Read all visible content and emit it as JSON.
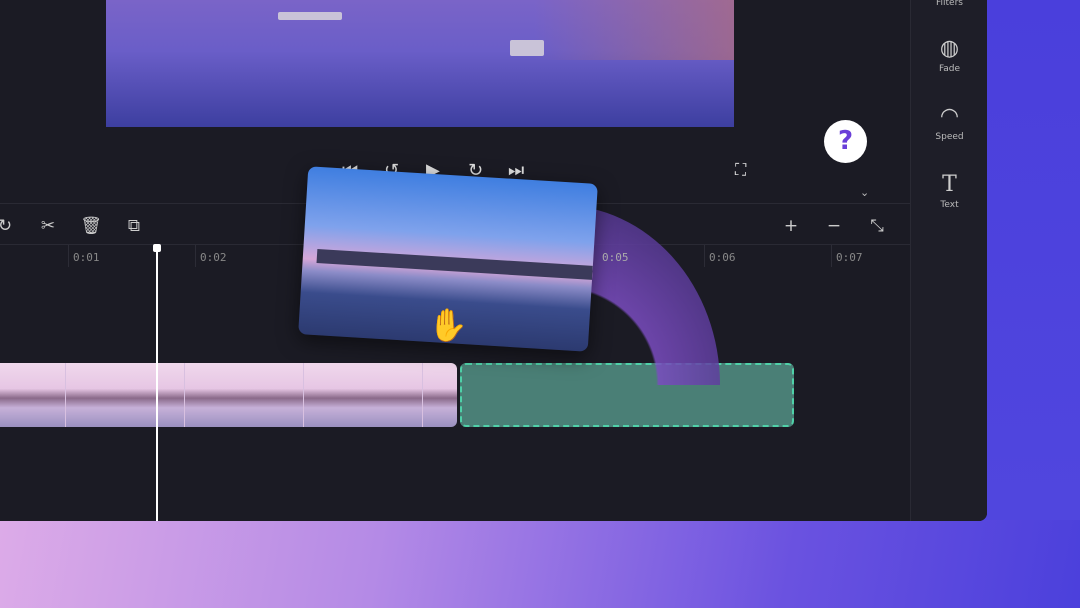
{
  "sidebar": {
    "items": [
      {
        "label": "Filters",
        "icon": "filters-icon"
      },
      {
        "label": "Fade",
        "icon": "fade-icon"
      },
      {
        "label": "Speed",
        "icon": "speed-icon"
      },
      {
        "label": "Text",
        "icon": "text-icon"
      }
    ]
  },
  "help": {
    "label": "?"
  },
  "ruler": {
    "ticks": [
      "0:01",
      "0:02",
      "0:05",
      "0:06",
      "0:07"
    ]
  },
  "colors": {
    "drop_zone": "#4a7f76",
    "drop_border": "#4fd1a8",
    "accent": "#6a3fd8",
    "background": "#4b40dc"
  }
}
